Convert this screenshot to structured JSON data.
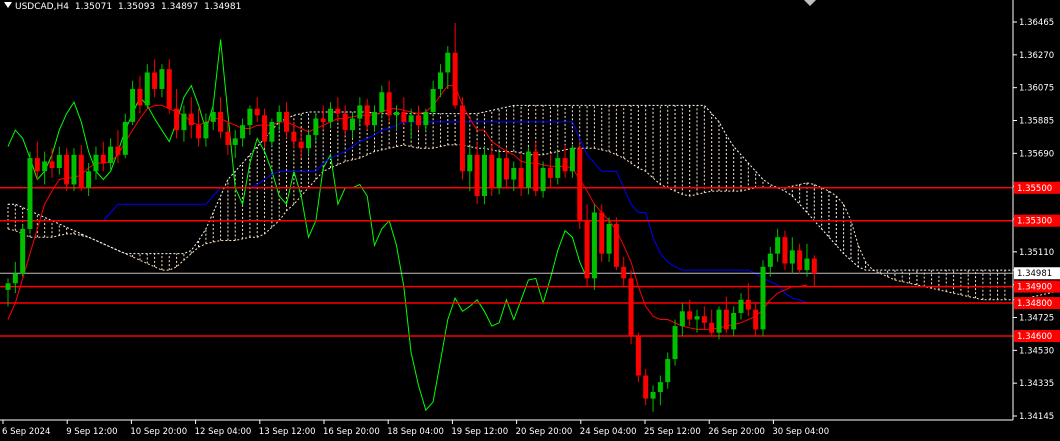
{
  "header": {
    "symbol": "USDCAD,H4",
    "open": "1.35071",
    "high": "1.35093",
    "low": "1.34897",
    "close": "1.34981"
  },
  "colors": {
    "background": "#000000",
    "grid_axis": "#ffffff",
    "bull": "#00c000",
    "bear": "#ff0000",
    "tenkan": "#ff0000",
    "kijun": "#0000ff",
    "chikou": "#00ff00",
    "cloud_up": "#ffe4c4",
    "cloud_down": "#ffffff",
    "level_line": "#ff0000",
    "price_line": "#c0c0c0"
  },
  "chart_data": {
    "type": "candlestick",
    "y_ticks": [
      "1.36465",
      "1.36270",
      "1.36075",
      "1.35885",
      "1.35690",
      "1.35510",
      "1.35315",
      "1.35110",
      "1.34915",
      "1.34725",
      "1.34530",
      "1.34335",
      "1.34145"
    ],
    "x_ticks": [
      "6 Sep 2024",
      "9 Sep 12:00",
      "10 Sep 20:00",
      "12 Sep 04:00",
      "13 Sep 12:00",
      "16 Sep 20:00",
      "18 Sep 04:00",
      "19 Sep 12:00",
      "20 Sep 20:00",
      "24 Sep 04:00",
      "25 Sep 12:00",
      "26 Sep 20:00",
      "30 Sep 04:00"
    ],
    "ylim": [
      1.3409,
      1.3664
    ],
    "levels": [
      {
        "label": "1.35500",
        "value": 1.355
      },
      {
        "label": "1.35300",
        "value": 1.353
      },
      {
        "label": "1.34900",
        "value": 1.349
      },
      {
        "label": "1.34800",
        "value": 1.348
      },
      {
        "label": "1.34600",
        "value": 1.346
      }
    ],
    "current_price": {
      "label": "1.34981",
      "value": 1.34981
    },
    "candles": [
      [
        1.3488,
        1.3495,
        1.3478,
        1.3492
      ],
      [
        1.3492,
        1.3505,
        1.3486,
        1.3498
      ],
      [
        1.3498,
        1.3528,
        1.3496,
        1.3525
      ],
      [
        1.3525,
        1.3572,
        1.3522,
        1.3568
      ],
      [
        1.3568,
        1.3578,
        1.3555,
        1.356
      ],
      [
        1.356,
        1.3572,
        1.3552,
        1.3566
      ],
      [
        1.3566,
        1.3574,
        1.3556,
        1.3562
      ],
      [
        1.3562,
        1.3575,
        1.3558,
        1.357
      ],
      [
        1.357,
        1.3574,
        1.3548,
        1.3552
      ],
      [
        1.3552,
        1.3574,
        1.3548,
        1.357
      ],
      [
        1.357,
        1.3576,
        1.3548,
        1.355
      ],
      [
        1.355,
        1.3565,
        1.3545,
        1.356
      ],
      [
        1.356,
        1.3575,
        1.3555,
        1.357
      ],
      [
        1.357,
        1.3578,
        1.356,
        1.3565
      ],
      [
        1.3565,
        1.358,
        1.356,
        1.3575
      ],
      [
        1.3575,
        1.3585,
        1.3565,
        1.357
      ],
      [
        1.357,
        1.3595,
        1.3568,
        1.359
      ],
      [
        1.359,
        1.3615,
        1.3588,
        1.361
      ],
      [
        1.361,
        1.3618,
        1.3595,
        1.36
      ],
      [
        1.36,
        1.3625,
        1.3598,
        1.362
      ],
      [
        1.362,
        1.3628,
        1.3605,
        1.361
      ],
      [
        1.361,
        1.3625,
        1.3605,
        1.3622
      ],
      [
        1.3622,
        1.3628,
        1.3595,
        1.3598
      ],
      [
        1.3598,
        1.361,
        1.358,
        1.3585
      ],
      [
        1.3585,
        1.36,
        1.3578,
        1.3595
      ],
      [
        1.3595,
        1.3605,
        1.358,
        1.3588
      ],
      [
        1.3588,
        1.3598,
        1.3575,
        1.358
      ],
      [
        1.358,
        1.3595,
        1.3575,
        1.359
      ],
      [
        1.359,
        1.3602,
        1.3585,
        1.3596
      ],
      [
        1.3596,
        1.3605,
        1.358,
        1.3584
      ],
      [
        1.3584,
        1.359,
        1.357,
        1.3576
      ],
      [
        1.3576,
        1.3585,
        1.3568,
        1.358
      ],
      [
        1.358,
        1.3592,
        1.3575,
        1.3588
      ],
      [
        1.3588,
        1.36,
        1.3582,
        1.3598
      ],
      [
        1.3598,
        1.3605,
        1.359,
        1.3594
      ],
      [
        1.3594,
        1.3598,
        1.3574,
        1.3578
      ],
      [
        1.3578,
        1.3592,
        1.3575,
        1.359
      ],
      [
        1.359,
        1.36,
        1.3585,
        1.3596
      ],
      [
        1.3596,
        1.3602,
        1.358,
        1.3584
      ],
      [
        1.3584,
        1.359,
        1.3574,
        1.3578
      ],
      [
        1.3578,
        1.3584,
        1.3568,
        1.3574
      ],
      [
        1.3574,
        1.3585,
        1.357,
        1.3582
      ],
      [
        1.3582,
        1.3595,
        1.3578,
        1.3592
      ],
      [
        1.3592,
        1.36,
        1.3585,
        1.359
      ],
      [
        1.359,
        1.3602,
        1.3586,
        1.3598
      ],
      [
        1.3598,
        1.3605,
        1.359,
        1.3595
      ],
      [
        1.3595,
        1.36,
        1.3582,
        1.3585
      ],
      [
        1.3585,
        1.3596,
        1.358,
        1.3592
      ],
      [
        1.3592,
        1.3605,
        1.3588,
        1.36
      ],
      [
        1.36,
        1.3604,
        1.3585,
        1.3588
      ],
      [
        1.3588,
        1.36,
        1.3584,
        1.3596
      ],
      [
        1.3596,
        1.3612,
        1.3592,
        1.3608
      ],
      [
        1.3608,
        1.3615,
        1.359,
        1.3594
      ],
      [
        1.3594,
        1.36,
        1.3585,
        1.3596
      ],
      [
        1.3596,
        1.3605,
        1.3588,
        1.359
      ],
      [
        1.359,
        1.3598,
        1.358,
        1.3594
      ],
      [
        1.3594,
        1.36,
        1.3585,
        1.3588
      ],
      [
        1.3588,
        1.3598,
        1.3584,
        1.3596
      ],
      [
        1.3596,
        1.3615,
        1.3594,
        1.361
      ],
      [
        1.361,
        1.3625,
        1.3605,
        1.362
      ],
      [
        1.362,
        1.3636,
        1.361,
        1.3632
      ],
      [
        1.3632,
        1.365,
        1.3598,
        1.36
      ],
      [
        1.36,
        1.3605,
        1.3555,
        1.356
      ],
      [
        1.356,
        1.3575,
        1.3548,
        1.357
      ],
      [
        1.357,
        1.3578,
        1.354,
        1.3545
      ],
      [
        1.3545,
        1.3575,
        1.354,
        1.357
      ],
      [
        1.357,
        1.3576,
        1.3545,
        1.355
      ],
      [
        1.355,
        1.3572,
        1.3546,
        1.3568
      ],
      [
        1.3568,
        1.3574,
        1.355,
        1.3555
      ],
      [
        1.3555,
        1.3566,
        1.3548,
        1.3562
      ],
      [
        1.3562,
        1.357,
        1.3545,
        1.355
      ],
      [
        1.355,
        1.3575,
        1.3546,
        1.3572
      ],
      [
        1.3572,
        1.3578,
        1.3545,
        1.3548
      ],
      [
        1.3548,
        1.3566,
        1.3544,
        1.3562
      ],
      [
        1.3562,
        1.357,
        1.355,
        1.3556
      ],
      [
        1.3556,
        1.3572,
        1.3552,
        1.3568
      ],
      [
        1.3568,
        1.3576,
        1.3556,
        1.356
      ],
      [
        1.356,
        1.3576,
        1.3556,
        1.3574
      ],
      [
        1.3574,
        1.3578,
        1.3525,
        1.353
      ],
      [
        1.353,
        1.354,
        1.349,
        1.3495
      ],
      [
        1.3495,
        1.354,
        1.3488,
        1.3535
      ],
      [
        1.3535,
        1.354,
        1.3505,
        1.351
      ],
      [
        1.351,
        1.3532,
        1.3505,
        1.3528
      ],
      [
        1.3528,
        1.3532,
        1.35,
        1.3502
      ],
      [
        1.3502,
        1.3508,
        1.349,
        1.3495
      ],
      [
        1.3495,
        1.35,
        1.3455,
        1.346
      ],
      [
        1.346,
        1.3462,
        1.3432,
        1.3436
      ],
      [
        1.3436,
        1.344,
        1.3418,
        1.3422
      ],
      [
        1.3422,
        1.343,
        1.3414,
        1.3426
      ],
      [
        1.3426,
        1.3436,
        1.3418,
        1.3432
      ],
      [
        1.3432,
        1.345,
        1.3428,
        1.3446
      ],
      [
        1.3446,
        1.347,
        1.3442,
        1.3466
      ],
      [
        1.3466,
        1.348,
        1.346,
        1.3475
      ],
      [
        1.3475,
        1.3482,
        1.3466,
        1.347
      ],
      [
        1.347,
        1.3476,
        1.3462,
        1.3472
      ],
      [
        1.3472,
        1.3478,
        1.3464,
        1.3468
      ],
      [
        1.3468,
        1.3476,
        1.346,
        1.3462
      ],
      [
        1.3462,
        1.3478,
        1.3458,
        1.3476
      ],
      [
        1.3476,
        1.3484,
        1.3462,
        1.3464
      ],
      [
        1.3464,
        1.3478,
        1.346,
        1.3474
      ],
      [
        1.3474,
        1.3486,
        1.347,
        1.3482
      ],
      [
        1.3482,
        1.3492,
        1.3472,
        1.3476
      ],
      [
        1.3476,
        1.348,
        1.346,
        1.3464
      ],
      [
        1.3464,
        1.3506,
        1.346,
        1.3502
      ],
      [
        1.3502,
        1.3514,
        1.3496,
        1.351
      ],
      [
        1.351,
        1.3525,
        1.3505,
        1.352
      ],
      [
        1.352,
        1.3524,
        1.35,
        1.3504
      ],
      [
        1.3504,
        1.352,
        1.3498,
        1.3512
      ],
      [
        1.3512,
        1.3516,
        1.3498,
        1.35
      ],
      [
        1.35,
        1.3516,
        1.3496,
        1.3507
      ],
      [
        1.3507,
        1.3509,
        1.349,
        1.3498
      ]
    ],
    "tenkan": [
      1.347,
      1.348,
      1.3495,
      1.351,
      1.3525,
      1.354,
      1.3548,
      1.3555,
      1.3556,
      1.3556,
      1.3558,
      1.3562,
      1.3565,
      1.3565,
      1.3566,
      1.357,
      1.3578,
      1.3585,
      1.3592,
      1.3598,
      1.36,
      1.36,
      1.3598,
      1.3596,
      1.3594,
      1.359,
      1.3588,
      1.359,
      1.3592,
      1.3592,
      1.359,
      1.3588,
      1.3586,
      1.3586,
      1.3588,
      1.3588,
      1.3588,
      1.359,
      1.359,
      1.3588,
      1.3586,
      1.3584,
      1.3586,
      1.3588,
      1.359,
      1.3592,
      1.3592,
      1.3593,
      1.3594,
      1.3594,
      1.3594,
      1.3596,
      1.3598,
      1.3598,
      1.3597,
      1.3596,
      1.3595,
      1.3596,
      1.36,
      1.3606,
      1.3612,
      1.3612,
      1.36,
      1.3592,
      1.3585,
      1.3585,
      1.3578,
      1.3575,
      1.3572,
      1.357,
      1.3566,
      1.3565,
      1.3565,
      1.3564,
      1.3563,
      1.3563,
      1.3563,
      1.3562,
      1.3555,
      1.3548,
      1.354,
      1.3535,
      1.353,
      1.3524,
      1.3515,
      1.3505,
      1.349,
      1.3478,
      1.3472,
      1.347,
      1.347,
      1.3468,
      1.3466,
      1.3465,
      1.3464,
      1.3464,
      1.3464,
      1.3465,
      1.3466,
      1.3467,
      1.3468,
      1.347,
      1.3472,
      1.3476,
      1.3482,
      1.3486,
      1.3488,
      1.349,
      1.349,
      1.3491
    ],
    "kijun": [
      1.353,
      1.353,
      1.353,
      1.353,
      1.353,
      1.353,
      1.353,
      1.353,
      1.353,
      1.353,
      1.353,
      1.353,
      1.353,
      1.353,
      1.3535,
      1.354,
      1.354,
      1.354,
      1.354,
      1.354,
      1.354,
      1.354,
      1.354,
      1.354,
      1.354,
      1.354,
      1.354,
      1.354,
      1.3545,
      1.355,
      1.355,
      1.355,
      1.355,
      1.355,
      1.3552,
      1.3555,
      1.3558,
      1.356,
      1.356,
      1.356,
      1.356,
      1.356,
      1.356,
      1.3565,
      1.3568,
      1.357,
      1.3572,
      1.3575,
      1.3578,
      1.358,
      1.3582,
      1.3585,
      1.3586,
      1.3588,
      1.359,
      1.359,
      1.359,
      1.359,
      1.359,
      1.359,
      1.359,
      1.359,
      1.359,
      1.359,
      1.359,
      1.359,
      1.359,
      1.359,
      1.359,
      1.359,
      1.359,
      1.359,
      1.359,
      1.359,
      1.359,
      1.359,
      1.359,
      1.359,
      1.358,
      1.357,
      1.3565,
      1.356,
      1.356,
      1.356,
      1.355,
      1.354,
      1.3535,
      1.3535,
      1.352,
      1.351,
      1.3505,
      1.3502,
      1.35,
      1.35,
      1.35,
      1.35,
      1.35,
      1.35,
      1.35,
      1.35,
      1.35,
      1.35,
      1.3498,
      1.3495,
      1.3493,
      1.3491,
      1.3486,
      1.3483,
      1.3482,
      1.348
    ],
    "chikou": [
      1.3575,
      1.3585,
      1.358,
      1.3568,
      1.3555,
      1.356,
      1.357,
      1.3585,
      1.3595,
      1.3602,
      1.359,
      1.3572,
      1.356,
      1.3555,
      1.356,
      1.3572,
      1.3585,
      1.3595,
      1.3605,
      1.36,
      1.3592,
      1.3585,
      1.3578,
      1.359,
      1.3605,
      1.3612,
      1.36,
      1.3585,
      1.36,
      1.364,
      1.3595,
      1.355,
      1.354,
      1.3565,
      1.358,
      1.3572,
      1.356,
      1.3545,
      1.354,
      1.356,
      1.3545,
      1.352,
      1.353,
      1.3562,
      1.357,
      1.354,
      1.355,
      1.355,
      1.3552,
      1.3545,
      1.3515,
      1.3525,
      1.353,
      1.3515,
      1.349,
      1.345,
      1.343,
      1.3415,
      1.342,
      1.3445,
      1.347,
      1.3483,
      1.3475,
      1.3478,
      1.3482,
      1.3475,
      1.3466,
      1.3468,
      1.3482,
      1.347,
      1.3482,
      1.3494,
      1.3495,
      1.348,
      1.3495,
      1.3512,
      1.3524,
      1.352,
      1.3505,
      1.3495
    ],
    "span_a": [
      1.3525,
      1.3524,
      1.3522,
      1.352,
      1.352,
      1.352,
      1.352,
      1.3521,
      1.3522,
      1.3522,
      1.3521,
      1.352,
      1.3518,
      1.3516,
      1.3514,
      1.3512,
      1.351,
      1.3508,
      1.3506,
      1.3504,
      1.3502,
      1.35,
      1.35,
      1.3502,
      1.3506,
      1.351,
      1.3514,
      1.3516,
      1.3517,
      1.3518,
      1.3518,
      1.3518,
      1.3519,
      1.352,
      1.352,
      1.3522,
      1.3526,
      1.353,
      1.3536,
      1.354,
      1.3545,
      1.355,
      1.3555,
      1.356,
      1.3562,
      1.3564,
      1.3566,
      1.3567,
      1.3568,
      1.357,
      1.3572,
      1.3573,
      1.3574,
      1.3575,
      1.3576,
      1.3575,
      1.3574,
      1.3574,
      1.3574,
      1.3575,
      1.3576,
      1.3576,
      1.3576,
      1.3575,
      1.3574,
      1.3574,
      1.3573,
      1.3572,
      1.3572,
      1.3572,
      1.3571,
      1.357,
      1.357,
      1.357,
      1.3571,
      1.3572,
      1.3573,
      1.3574,
      1.3574,
      1.3574,
      1.3574,
      1.3573,
      1.3572,
      1.357,
      1.3568,
      1.3565,
      1.3562,
      1.356,
      1.3556,
      1.3552,
      1.355,
      1.3548,
      1.3546,
      1.3545,
      1.3546,
      1.3547,
      1.3548,
      1.3548,
      1.3548,
      1.3548,
      1.3548,
      1.3549,
      1.355,
      1.355,
      1.355,
      1.355,
      1.355,
      1.3551,
      1.3552,
      1.3553,
      1.3552,
      1.355,
      1.3548,
      1.3545,
      1.354,
      1.353,
      1.3515,
      1.3505,
      1.35,
      1.3498,
      1.3496,
      1.3494,
      1.3493,
      1.3492,
      1.3491,
      1.349,
      1.3489,
      1.3488,
      1.3487,
      1.3486,
      1.3485,
      1.3484,
      1.3483,
      1.3482,
      1.3482,
      1.3482,
      1.3482,
      1.3482,
      1.3482,
      1.3483,
      1.3484,
      1.3485,
      1.3486,
      1.3487,
      1.3488,
      1.3488,
      1.3488,
      1.3487,
      1.3486,
      1.3486
    ],
    "span_b": [
      1.354,
      1.354,
      1.3538,
      1.3536,
      1.3534,
      1.3532,
      1.353,
      1.3528,
      1.3526,
      1.3524,
      1.3522,
      1.352,
      1.3518,
      1.3516,
      1.3514,
      1.3512,
      1.351,
      1.351,
      1.351,
      1.351,
      1.351,
      1.351,
      1.351,
      1.351,
      1.351,
      1.3512,
      1.3518,
      1.3525,
      1.3535,
      1.3545,
      1.3555,
      1.356,
      1.3565,
      1.357,
      1.3575,
      1.358,
      1.3585,
      1.359,
      1.3592,
      1.3594,
      1.3595,
      1.3596,
      1.3596,
      1.3596,
      1.3596,
      1.3596,
      1.3596,
      1.3596,
      1.3596,
      1.3596,
      1.3595,
      1.3595,
      1.3595,
      1.3595,
      1.3595,
      1.3595,
      1.3595,
      1.3595,
      1.3595,
      1.3595,
      1.3595,
      1.3595,
      1.3595,
      1.3595,
      1.3595,
      1.3596,
      1.3597,
      1.3598,
      1.3599,
      1.36,
      1.36,
      1.36,
      1.36,
      1.36,
      1.36,
      1.36,
      1.36,
      1.36,
      1.36,
      1.36,
      1.36,
      1.36,
      1.36,
      1.36,
      1.36,
      1.36,
      1.36,
      1.36,
      1.36,
      1.36,
      1.36,
      1.36,
      1.36,
      1.36,
      1.36,
      1.36,
      1.3595,
      1.359,
      1.3582,
      1.3575,
      1.357,
      1.3565,
      1.356,
      1.3555,
      1.3552,
      1.355,
      1.3548,
      1.3545,
      1.354,
      1.3535,
      1.353,
      1.3525,
      1.352,
      1.3515,
      1.351,
      1.3506,
      1.3502,
      1.35,
      1.35,
      1.35,
      1.35,
      1.35,
      1.35,
      1.35,
      1.35,
      1.35,
      1.35,
      1.35,
      1.35,
      1.35,
      1.35,
      1.35,
      1.35,
      1.35,
      1.35,
      1.35,
      1.35,
      1.35,
      1.35,
      1.35,
      1.35,
      1.35,
      1.35,
      1.35,
      1.35,
      1.35,
      1.35
    ]
  }
}
